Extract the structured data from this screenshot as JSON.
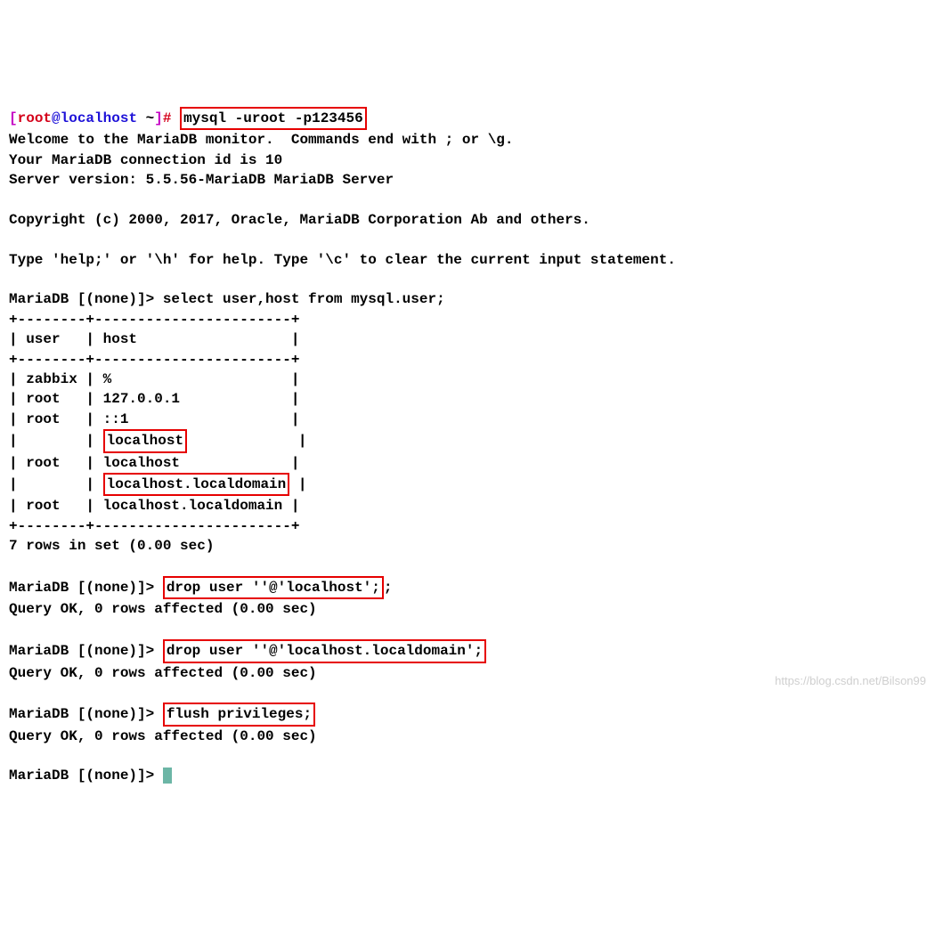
{
  "prompt": {
    "bracket_open": "[",
    "user": "root",
    "at": "@",
    "host": "localhost",
    "tilde": " ~",
    "bracket_close": "]",
    "hash": "# "
  },
  "cmd1": "mysql -uroot -p123456",
  "output": {
    "l1": "Welcome to the MariaDB monitor.  Commands end with ; or \\g.",
    "l2": "Your MariaDB connection id is 10",
    "l3": "Server version: 5.5.56-MariaDB MariaDB Server",
    "l4": "Copyright (c) 2000, 2017, Oracle, MariaDB Corporation Ab and others.",
    "l5": "Type 'help;' or '\\h' for help. Type '\\c' to clear the current input statement."
  },
  "db_prompt": "MariaDB [(none)]> ",
  "sql1": "select user,host from mysql.user;",
  "table": {
    "border": "+--------+-----------------------+",
    "header": "| user   | host                  |",
    "r1": "| zabbix | %                     |",
    "r2": "| root   | 127.0.0.1             |",
    "r3": "| root   | ::1                   |",
    "r4_pre": "|        | ",
    "r4_box": "localhost",
    "r4_post": "             |",
    "r5": "| root   | localhost             |",
    "r6_pre": "|        | ",
    "r6_box": "localhost.localdomain",
    "r6_post": " |",
    "r7": "| root   | localhost.localdomain |"
  },
  "rows_msg": "7 rows in set (0.00 sec)",
  "sql2": "drop user ''@'localhost';",
  "sql2_semi": ";",
  "ok_msg": "Query OK, 0 rows affected (0.00 sec)",
  "sql3": "drop user ''@'localhost.localdomain';",
  "sql4": "flush privileges;",
  "watermark": "https://blog.csdn.net/Bilson99"
}
